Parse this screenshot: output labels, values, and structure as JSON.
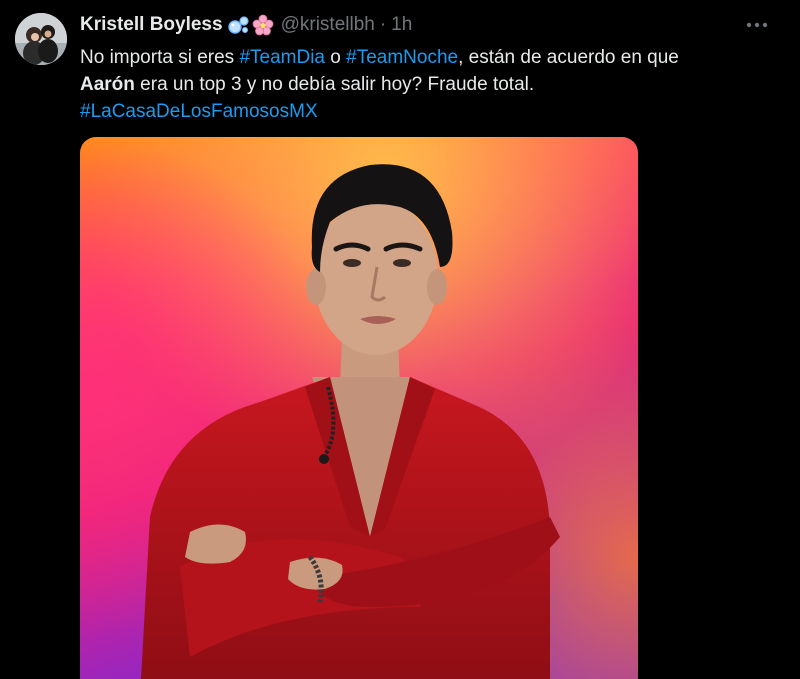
{
  "author": {
    "display_name": "Kristell Boyless",
    "handle": "@kristellbh",
    "separator": "·",
    "time": "1h",
    "avatar_icon": "profile-photo-avatar",
    "name_emojis": [
      "bubbles-emoji",
      "cherry-blossom-emoji"
    ]
  },
  "more_icon": "ellipsis-icon",
  "text": {
    "part1": "No importa si eres ",
    "hashtag1": "#TeamDia",
    "part2": " o ",
    "hashtag2": "#TeamNoche",
    "part3": ", están de acuerdo en que ",
    "bold_name": "Aarón",
    "part4": " era un top 3 y no debía salir hoy? Fraude total.",
    "hashtag3": "#LaCasaDeLosFamososMX"
  },
  "media": {
    "description_icon": "portrait-photo",
    "colors": {
      "orange": "#ff9a1f",
      "pink": "#f0267a",
      "purple": "#8a2be2",
      "shirt_red": "#b1121c"
    }
  },
  "colors": {
    "background": "#000000",
    "text": "#e7e9ea",
    "secondary": "#71767b",
    "link": "#1d9bf0"
  }
}
